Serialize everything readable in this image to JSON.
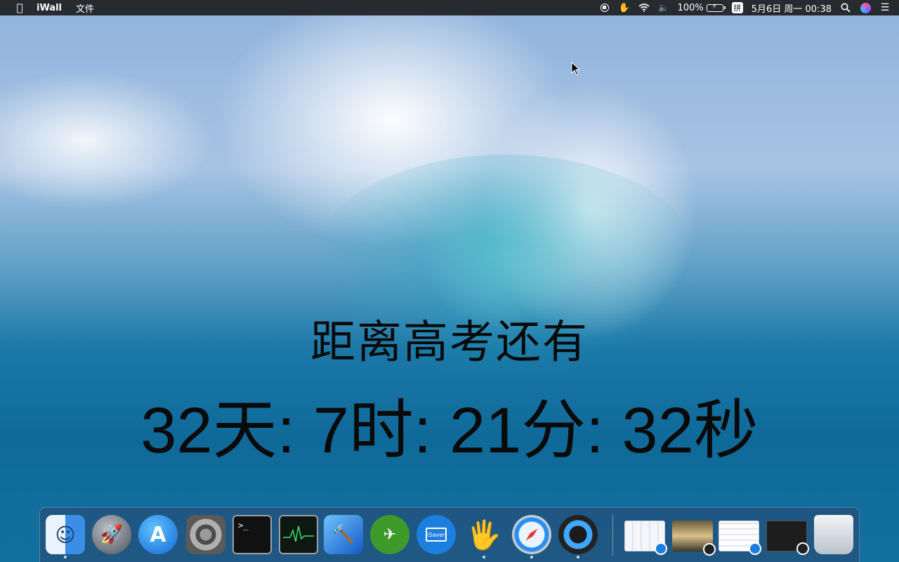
{
  "menubar": {
    "apple_icon": "apple-logo-icon",
    "app_name": "iWall",
    "menus": [
      "文件"
    ],
    "battery": "100%",
    "input_method": "拼",
    "datetime": "5月6日 周一  00:38"
  },
  "countdown": {
    "title": "距离高考还有",
    "value": "32天: 7时: 21分: 32秒"
  },
  "dock": {
    "apps": [
      {
        "name": "Finder",
        "icon": "finder-icon",
        "running": true
      },
      {
        "name": "Launchpad",
        "icon": "launchpad-icon",
        "running": false
      },
      {
        "name": "App Store",
        "icon": "app-store-icon",
        "running": false
      },
      {
        "name": "System Preferences",
        "icon": "system-preferences-icon",
        "running": false
      },
      {
        "name": "Terminal",
        "icon": "terminal-icon",
        "running": false
      },
      {
        "name": "Activity Monitor",
        "icon": "activity-monitor-icon",
        "running": false
      },
      {
        "name": "Xcode",
        "icon": "xcode-icon",
        "running": false
      },
      {
        "name": "Cloud app",
        "icon": "cloud-app-icon",
        "running": false
      },
      {
        "name": "iSaver",
        "icon": "isaver-icon",
        "running": false
      },
      {
        "name": "iWall",
        "icon": "iwall-hand-icon",
        "running": true
      },
      {
        "name": "Safari",
        "icon": "safari-icon",
        "running": true
      },
      {
        "name": "QuickTime Player",
        "icon": "quicktime-icon",
        "running": true
      }
    ],
    "terminal_prompt": ">_",
    "isaver_label": "iSaver"
  }
}
